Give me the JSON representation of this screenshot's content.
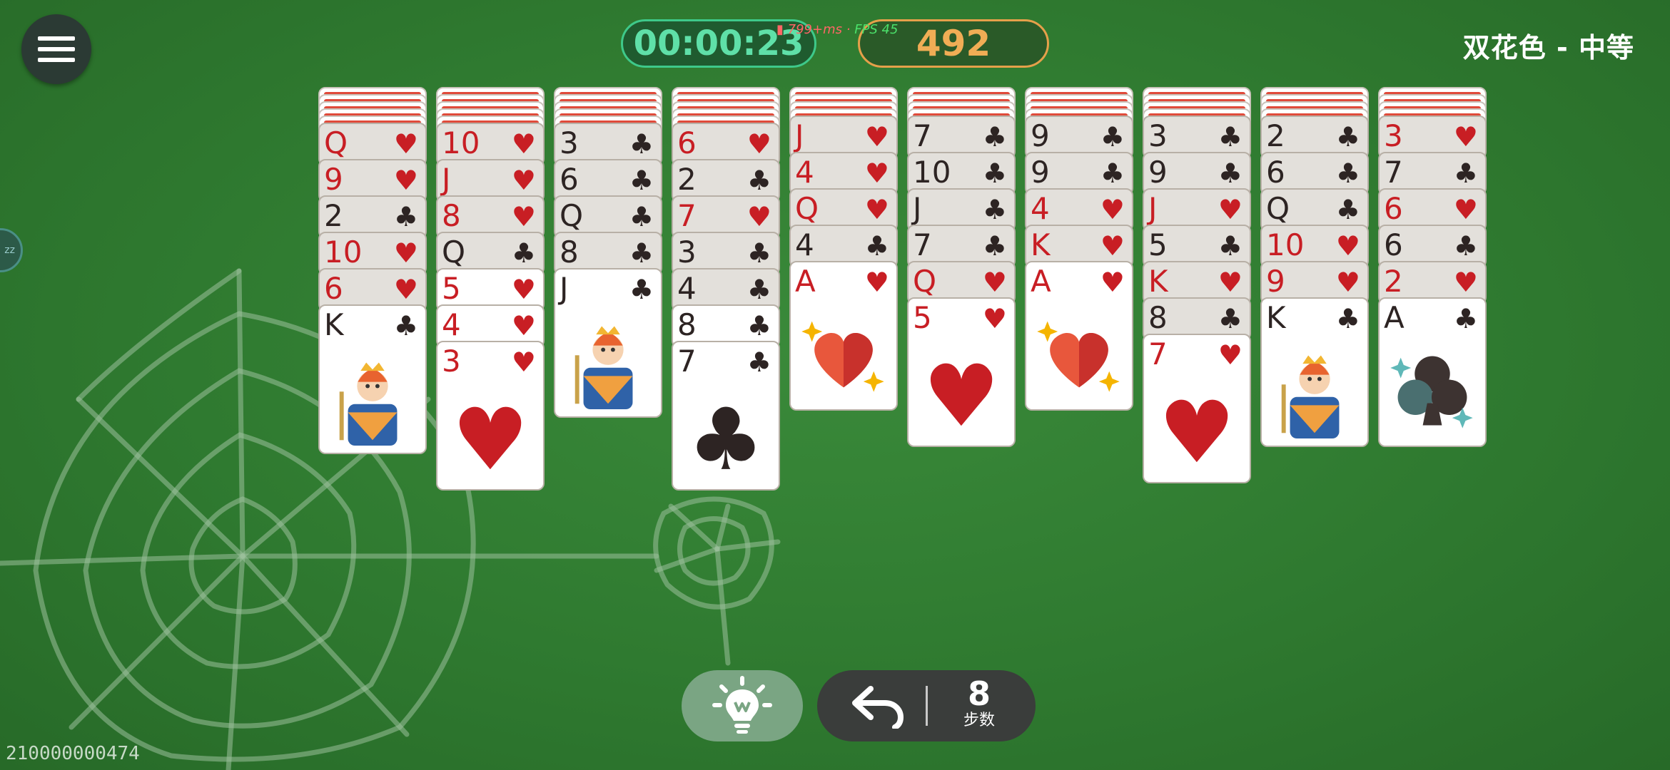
{
  "header": {
    "timer": "00:00:23",
    "score": "492",
    "debug_ping": "799+ms",
    "debug_fps": "FPS 45",
    "mode_title": "双花色 - 中等"
  },
  "footer": {
    "seed": "210000000474",
    "moves_count": "8",
    "moves_label": "步数"
  },
  "colors": {
    "felt": "#2e7d2e",
    "red_suit": "#c81e24",
    "black_suit": "#2d2423",
    "timer": "#3ec98a",
    "score": "#e5a04a"
  },
  "tableau": [
    {
      "backs": 5,
      "cards": [
        {
          "rank": "Q",
          "suit": "♥"
        },
        {
          "rank": "9",
          "suit": "♥"
        },
        {
          "rank": "2",
          "suit": "♣"
        },
        {
          "rank": "10",
          "suit": "♥"
        },
        {
          "rank": "6",
          "suit": "♥"
        },
        {
          "rank": "K",
          "suit": "♣",
          "face": "court"
        }
      ]
    },
    {
      "backs": 5,
      "cards": [
        {
          "rank": "10",
          "suit": "♥"
        },
        {
          "rank": "J",
          "suit": "♥"
        },
        {
          "rank": "8",
          "suit": "♥"
        },
        {
          "rank": "Q",
          "suit": "♣"
        },
        {
          "rank": "5",
          "suit": "♥",
          "up": true
        },
        {
          "rank": "4",
          "suit": "♥",
          "up": true
        },
        {
          "rank": "3",
          "suit": "♥",
          "face": "pip"
        }
      ]
    },
    {
      "backs": 5,
      "cards": [
        {
          "rank": "3",
          "suit": "♣"
        },
        {
          "rank": "6",
          "suit": "♣"
        },
        {
          "rank": "Q",
          "suit": "♣"
        },
        {
          "rank": "8",
          "suit": "♣"
        },
        {
          "rank": "J",
          "suit": "♣",
          "face": "court"
        }
      ]
    },
    {
      "backs": 5,
      "cards": [
        {
          "rank": "6",
          "suit": "♥"
        },
        {
          "rank": "2",
          "suit": "♣"
        },
        {
          "rank": "7",
          "suit": "♥"
        },
        {
          "rank": "3",
          "suit": "♣"
        },
        {
          "rank": "4",
          "suit": "♣"
        },
        {
          "rank": "8",
          "suit": "♣",
          "up": true
        },
        {
          "rank": "7",
          "suit": "♣",
          "face": "pip"
        }
      ]
    },
    {
      "backs": 4,
      "cards": [
        {
          "rank": "J",
          "suit": "♥"
        },
        {
          "rank": "4",
          "suit": "♥"
        },
        {
          "rank": "Q",
          "suit": "♥"
        },
        {
          "rank": "4",
          "suit": "♣"
        },
        {
          "rank": "A",
          "suit": "♥",
          "face": "ace"
        }
      ]
    },
    {
      "backs": 4,
      "cards": [
        {
          "rank": "7",
          "suit": "♣"
        },
        {
          "rank": "10",
          "suit": "♣"
        },
        {
          "rank": "J",
          "suit": "♣"
        },
        {
          "rank": "7",
          "suit": "♣"
        },
        {
          "rank": "Q",
          "suit": "♥"
        },
        {
          "rank": "5",
          "suit": "♥",
          "face": "pip"
        }
      ]
    },
    {
      "backs": 4,
      "cards": [
        {
          "rank": "9",
          "suit": "♣"
        },
        {
          "rank": "9",
          "suit": "♣"
        },
        {
          "rank": "4",
          "suit": "♥"
        },
        {
          "rank": "K",
          "suit": "♥"
        },
        {
          "rank": "A",
          "suit": "♥",
          "face": "ace"
        }
      ]
    },
    {
      "backs": 4,
      "cards": [
        {
          "rank": "3",
          "suit": "♣"
        },
        {
          "rank": "9",
          "suit": "♣"
        },
        {
          "rank": "J",
          "suit": "♥"
        },
        {
          "rank": "5",
          "suit": "♣"
        },
        {
          "rank": "K",
          "suit": "♥"
        },
        {
          "rank": "8",
          "suit": "♣"
        },
        {
          "rank": "7",
          "suit": "♥",
          "face": "pip"
        }
      ]
    },
    {
      "backs": 4,
      "cards": [
        {
          "rank": "2",
          "suit": "♣"
        },
        {
          "rank": "6",
          "suit": "♣"
        },
        {
          "rank": "Q",
          "suit": "♣"
        },
        {
          "rank": "10",
          "suit": "♥"
        },
        {
          "rank": "9",
          "suit": "♥"
        },
        {
          "rank": "K",
          "suit": "♣",
          "face": "court"
        }
      ]
    },
    {
      "backs": 4,
      "cards": [
        {
          "rank": "3",
          "suit": "♥"
        },
        {
          "rank": "7",
          "suit": "♣"
        },
        {
          "rank": "6",
          "suit": "♥"
        },
        {
          "rank": "6",
          "suit": "♣"
        },
        {
          "rank": "2",
          "suit": "♥"
        },
        {
          "rank": "A",
          "suit": "♣",
          "face": "ace"
        }
      ]
    }
  ],
  "icons": {
    "menu": "hamburger-icon",
    "hint": "lightbulb-icon",
    "undo": "undo-arrow-icon"
  }
}
